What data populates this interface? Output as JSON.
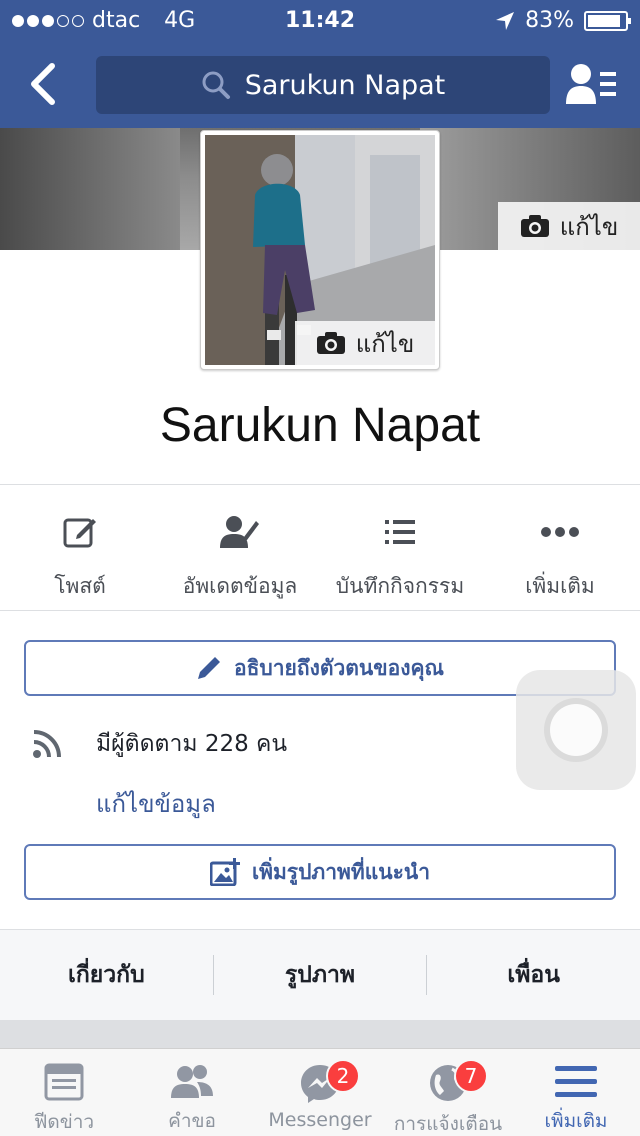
{
  "status_bar": {
    "carrier": "dtac",
    "network": "4G",
    "time": "11:42",
    "battery": "83%",
    "signal_bars": 3,
    "signal_max": 5
  },
  "nav": {
    "search_text": "Sarukun Napat"
  },
  "cover": {
    "edit_label": "แก้ไข"
  },
  "avatar": {
    "edit_label": "แก้ไข"
  },
  "profile": {
    "name": "Sarukun Napat"
  },
  "actions": [
    {
      "label": "โพสต์",
      "icon": "compose-icon"
    },
    {
      "label": "อัพเดตข้อมูล",
      "icon": "edit-profile-icon"
    },
    {
      "label": "บันทึกกิจกรรม",
      "icon": "activity-log-icon"
    },
    {
      "label": "เพิ่มเติม",
      "icon": "more-icon"
    }
  ],
  "intro": {
    "describe_button": "อธิบายถึงตัวตนของคุณ",
    "followers_text": "มีผู้ติดตาม 228 คน",
    "edit_details": "แก้ไขข้อมูล",
    "add_featured_button": "เพิ่มรูปภาพที่แนะนำ"
  },
  "tabs": [
    "เกี่ยวกับ",
    "รูปภาพ",
    "เพื่อน"
  ],
  "bottom_nav": [
    {
      "label": "ฟีดข่าว",
      "icon": "news-feed-icon"
    },
    {
      "label": "คำขอ",
      "icon": "friend-requests-icon"
    },
    {
      "label": "Messenger",
      "icon": "messenger-icon",
      "badge": "2"
    },
    {
      "label": "การแจ้งเตือน",
      "icon": "notifications-icon",
      "badge": "7"
    },
    {
      "label": "เพิ่มเติม",
      "icon": "more-menu-icon",
      "active": true
    }
  ],
  "colors": {
    "brand": "#3b5998",
    "link": "#3b5998",
    "badge": "#fa3e3e",
    "active_tab": "#4267b2"
  }
}
